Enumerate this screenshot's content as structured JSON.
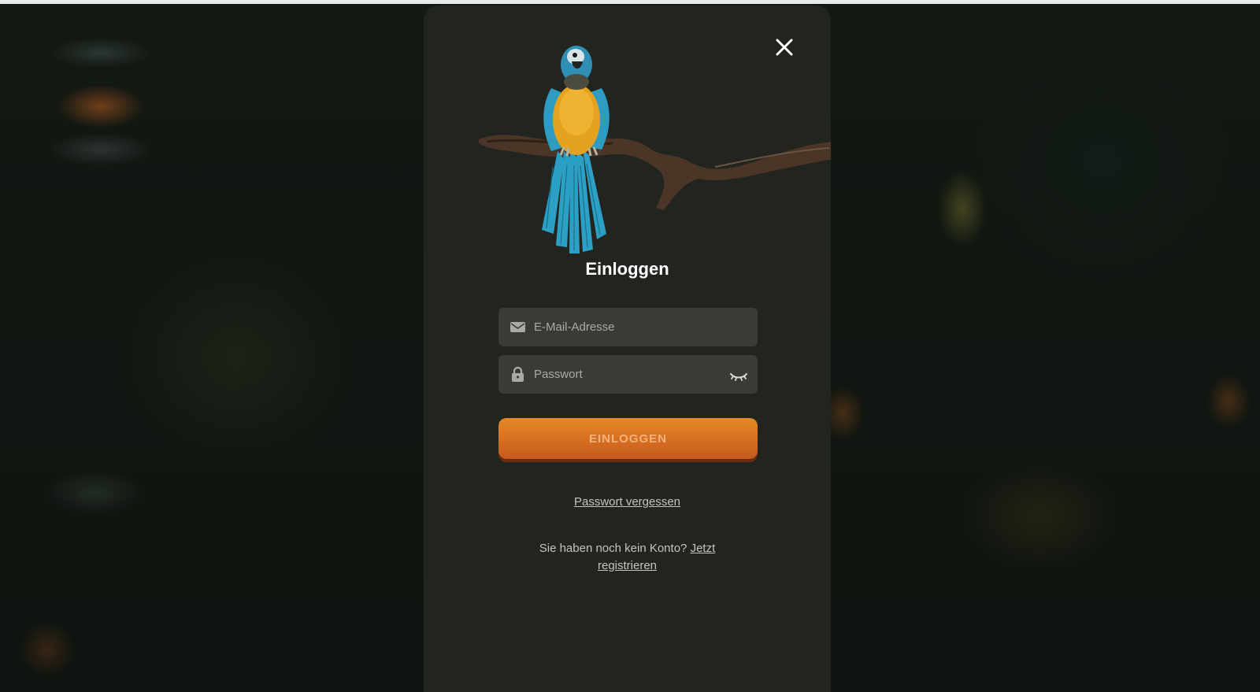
{
  "modal": {
    "close_icon": "close-icon",
    "hero_image": "parrot-on-branch",
    "title": "Einloggen",
    "email": {
      "placeholder": "E-Mail-Adresse",
      "icon": "envelope-icon"
    },
    "password": {
      "placeholder": "Passwort",
      "icon": "lock-icon",
      "toggle_icon": "eye-closed-icon"
    },
    "login_button": "EINLOGGEN",
    "forgot_link": "Passwort vergessen",
    "register_prompt": "Sie haben noch kein Konto?",
    "register_link": "Jetzt registrieren"
  },
  "colors": {
    "modal_bg": "#22241f",
    "field_bg": "#3a3b37",
    "button_orange": "#d97322",
    "page_bg": "#0d120f"
  }
}
